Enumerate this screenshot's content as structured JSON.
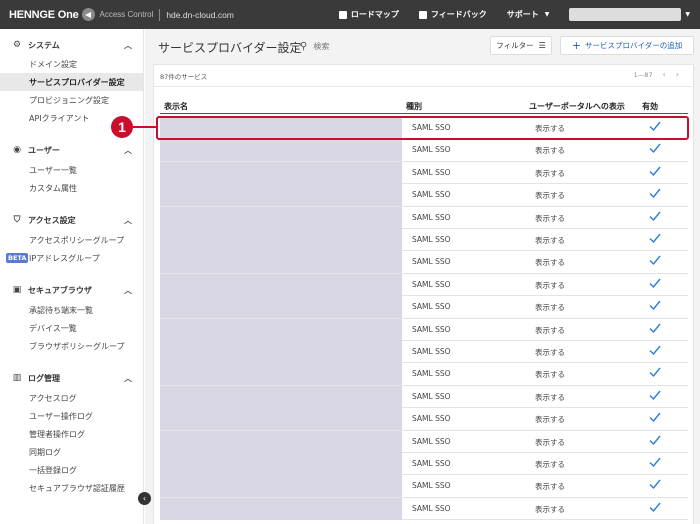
{
  "header": {
    "logo": "HENNGE One",
    "product": "Access Control",
    "domain": "hde.dn-cloud.com",
    "nav": [
      {
        "label": "ロードマップ",
        "icon": "map-icon"
      },
      {
        "label": "フィードバック",
        "icon": "feedback-icon"
      },
      {
        "label": "サポート",
        "icon": "chevron-down-icon"
      }
    ]
  },
  "sidebar": {
    "sections": [
      {
        "title": "システム",
        "icon": "gear-icon",
        "items": [
          "ドメイン設定",
          "サービスプロバイダー設定",
          "プロビジョニング設定",
          "APIクライアント"
        ]
      },
      {
        "title": "ユーザー",
        "icon": "user-icon",
        "items": [
          "ユーザー一覧",
          "カスタム属性"
        ]
      },
      {
        "title": "アクセス設定",
        "icon": "shield-icon",
        "items": [
          "アクセスポリシーグループ",
          "IPアドレスグループ"
        ]
      },
      {
        "title": "セキュアブラウザ",
        "icon": "browser-icon",
        "items": [
          "承認待ち端末一覧",
          "デバイス一覧",
          "ブラウザポリシーグループ"
        ]
      },
      {
        "title": "ログ管理",
        "icon": "bar-chart-icon",
        "items": [
          "アクセスログ",
          "ユーザー操作ログ",
          "管理者操作ログ",
          "同期ログ",
          "一括登録ログ",
          "セキュアブラウザ認証履歴"
        ]
      }
    ],
    "active_item": "サービスプロバイダー設定",
    "beta_badge": "BETA"
  },
  "main": {
    "title": "サービスプロバイダー設定",
    "search_placeholder": "検索",
    "filter_label": "フィルター",
    "add_label": "サービスプロバイダーの追加",
    "count": "87件のサービス",
    "pager": "1—87",
    "columns": {
      "name": "表示名",
      "type": "種別",
      "portal": "ユーザーポータルへの表示",
      "enabled": "有効"
    },
    "rows": [
      {
        "type": "SAML SSO",
        "portal": "表示する",
        "enabled": true
      },
      {
        "type": "SAML SSO",
        "portal": "表示する",
        "enabled": true
      },
      {
        "type": "SAML SSO",
        "portal": "表示する",
        "enabled": true
      },
      {
        "type": "SAML SSO",
        "portal": "表示する",
        "enabled": true
      },
      {
        "type": "SAML SSO",
        "portal": "表示する",
        "enabled": true
      },
      {
        "type": "SAML SSO",
        "portal": "表示する",
        "enabled": true
      },
      {
        "type": "SAML SSO",
        "portal": "表示する",
        "enabled": true
      },
      {
        "type": "SAML SSO",
        "portal": "表示する",
        "enabled": true
      },
      {
        "type": "SAML SSO",
        "portal": "表示する",
        "enabled": true
      },
      {
        "type": "SAML SSO",
        "portal": "表示する",
        "enabled": true
      },
      {
        "type": "SAML SSO",
        "portal": "表示する",
        "enabled": true
      },
      {
        "type": "SAML SSO",
        "portal": "表示する",
        "enabled": true
      },
      {
        "type": "SAML SSO",
        "portal": "表示する",
        "enabled": true
      },
      {
        "type": "SAML SSO",
        "portal": "表示する",
        "enabled": true
      },
      {
        "type": "SAML SSO",
        "portal": "表示する",
        "enabled": true
      },
      {
        "type": "SAML SSO",
        "portal": "表示する",
        "enabled": true
      },
      {
        "type": "SAML SSO",
        "portal": "表示する",
        "enabled": true
      },
      {
        "type": "SAML SSO",
        "portal": "表示する",
        "enabled": true
      }
    ]
  },
  "annotation": {
    "callout": "1"
  },
  "colors": {
    "accent": "#1c5fb5",
    "callout": "#c8102e",
    "check": "#2a7fd4",
    "redacted": "#d9d7e6"
  }
}
